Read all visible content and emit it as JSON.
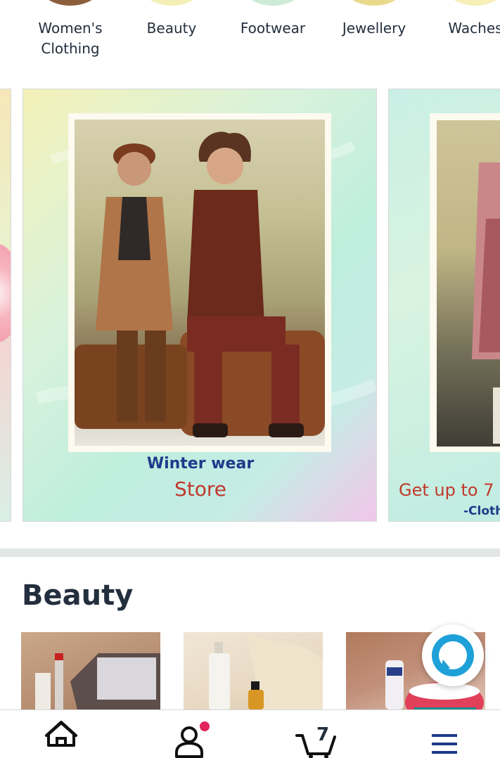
{
  "categories": [
    {
      "label": "Women's\nClothing",
      "circle_color": "#8b5e3c"
    },
    {
      "label": "Beauty",
      "circle_color": "#f3efb5"
    },
    {
      "label": "Footwear",
      "circle_color": "#cdebd6"
    },
    {
      "label": "Jewellery",
      "circle_color": "#e9d98a"
    },
    {
      "label": "Waches",
      "circle_color": "#f6efb8"
    }
  ],
  "carousel": {
    "main": {
      "line1": "Winter wear",
      "line2": "Store"
    },
    "right": {
      "line1": "Get up to 7",
      "line2": "-Cloth"
    }
  },
  "beauty_section": {
    "title": "Beauty"
  },
  "bottom_nav": {
    "cart_count": "7"
  },
  "colors": {
    "navy": "#232f3e",
    "notification": "#e0245e",
    "alexa_teal": "#1d8a8f"
  }
}
